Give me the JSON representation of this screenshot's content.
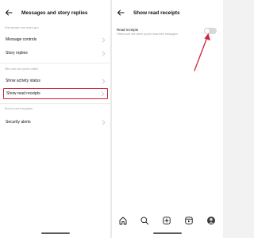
{
  "left": {
    "title": "Messages and story replies",
    "sections": [
      {
        "label": "How people can reach you",
        "items": [
          "Message controls",
          "Story replies"
        ]
      },
      {
        "label": "Who can see you're online",
        "items": [
          "Show activity status",
          "Show read receipts"
        ]
      },
      {
        "label": "End-to-end encryption",
        "items": [
          "Security alerts"
        ]
      }
    ],
    "highlighted_item": "Show read receipts",
    "highlight_color": "#d0233a"
  },
  "right": {
    "title": "Show read receipts",
    "setting": {
      "title": "Read receipts",
      "description": "Others can see when you've read their messages.",
      "toggle_on": false
    },
    "arrow_color": "#d0233a"
  },
  "bottom_nav": {
    "items": [
      "home-icon",
      "search-icon",
      "create-post-icon",
      "reels-icon",
      "profile-avatar"
    ]
  }
}
